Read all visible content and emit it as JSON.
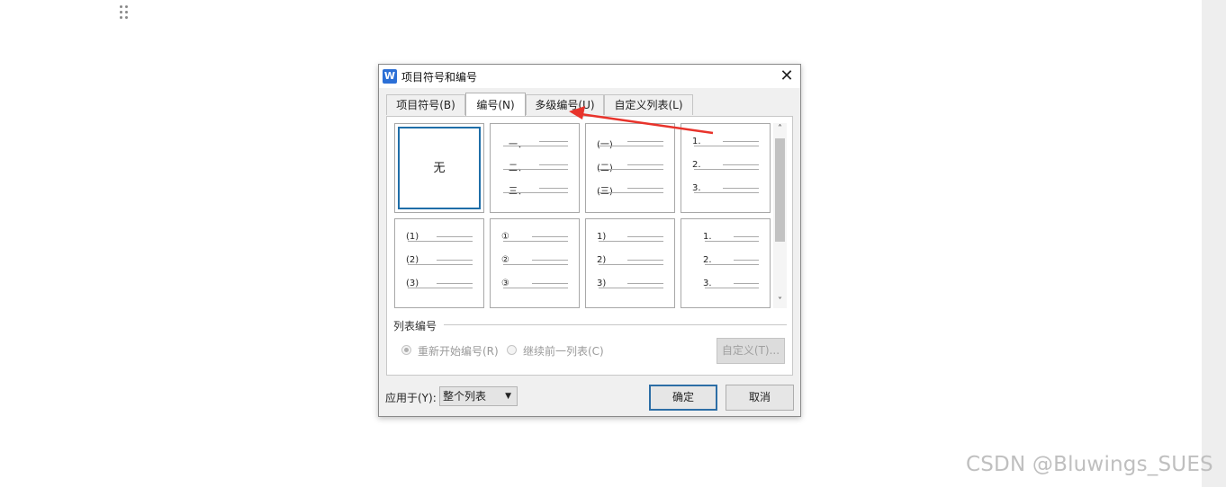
{
  "dialog": {
    "app_icon": "W",
    "title": "项目符号和编号",
    "close_glyph": "✕",
    "tabs": [
      {
        "label": "项目符号(B)",
        "active": false
      },
      {
        "label": "编号(N)",
        "active": true
      },
      {
        "label": "多级编号(U)",
        "active": false
      },
      {
        "label": "自定义列表(L)",
        "active": false
      }
    ],
    "numbering_styles": [
      {
        "name": "none",
        "label": "无",
        "selected": true,
        "items": []
      },
      {
        "name": "chinese-comma",
        "selected": false,
        "items": [
          "一、",
          "二、",
          "三、"
        ]
      },
      {
        "name": "chinese-paren",
        "selected": false,
        "items": [
          "(一)",
          "(二)",
          "(三)"
        ]
      },
      {
        "name": "arabic-dot",
        "selected": false,
        "items": [
          "1.",
          "2.",
          "3."
        ]
      },
      {
        "name": "arabic-paren",
        "selected": false,
        "items": [
          "(1)",
          "(2)",
          "(3)"
        ]
      },
      {
        "name": "circled",
        "selected": false,
        "items": [
          "①",
          "②",
          "③"
        ]
      },
      {
        "name": "arabic-half-paren",
        "selected": false,
        "items": [
          "1)",
          "2)",
          "3)"
        ]
      },
      {
        "name": "arabic-dot-indent",
        "selected": false,
        "items": [
          "1.",
          "2.",
          "3."
        ]
      }
    ],
    "scroll": {
      "up": "˄",
      "down": "˅"
    },
    "list_numbering": {
      "label": "列表编号",
      "restart_label": "重新开始编号(R)",
      "continue_label": "继续前一列表(C)",
      "custom_button": "自定义(T)..."
    },
    "apply_to": {
      "label": "应用于(Y):",
      "value": "整个列表",
      "arrow": "▼"
    },
    "buttons": {
      "ok": "确定",
      "cancel": "取消"
    }
  },
  "watermark": "CSDN @Bluwings_SUES",
  "colors": {
    "annotation_arrow": "#e8332b",
    "selection": "#1f6ea8",
    "app_icon": "#2b6fd6"
  }
}
